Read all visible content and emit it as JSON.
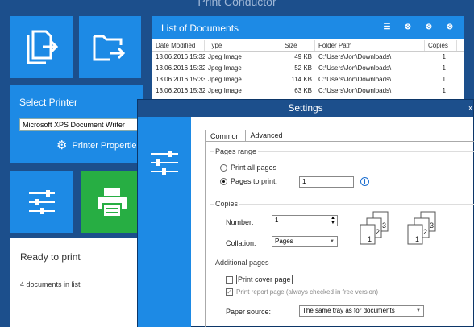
{
  "main_window": {
    "title": "Print Conductor"
  },
  "select_printer": {
    "label": "Select Printer",
    "printer_value": "Microsoft XPS Document Writer",
    "properties_label": "Printer Properties"
  },
  "status": {
    "ready": "Ready to print",
    "count": "4 documents in list"
  },
  "documents": {
    "title": "List of Documents",
    "columns": [
      "Date Modified",
      "Type",
      "Size",
      "Folder Path",
      "Copies"
    ],
    "rows": [
      {
        "date": "13.06.2016 15:32",
        "type": "Jpeg Image",
        "size": "49 KB",
        "path": "C:\\Users\\Jon\\Downloads\\",
        "copies": "1"
      },
      {
        "date": "13.06.2016 15:32",
        "type": "Jpeg Image",
        "size": "52 KB",
        "path": "C:\\Users\\Jon\\Downloads\\",
        "copies": "1"
      },
      {
        "date": "13.06.2016 15:33",
        "type": "Jpeg Image",
        "size": "114 KB",
        "path": "C:\\Users\\Jon\\Downloads\\",
        "copies": "1"
      },
      {
        "date": "13.06.2016 15:32",
        "type": "Jpeg Image",
        "size": "63 KB",
        "path": "C:\\Users\\Jon\\Downloads\\",
        "copies": "1"
      }
    ]
  },
  "settings": {
    "title": "Settings",
    "close": "x",
    "tabs": [
      "Common",
      "Advanced"
    ],
    "pages_range": {
      "title": "Pages range",
      "all_label": "Print all pages",
      "pages_label": "Pages to print:",
      "pages_value": "1",
      "info": "i"
    },
    "copies": {
      "title": "Copies",
      "number_label": "Number:",
      "number_value": "1",
      "collation_label": "Collation:",
      "collation_value": "Pages"
    },
    "additional": {
      "title": "Additional pages",
      "cover_label": "Print cover page",
      "report_label": "Print report page (always checked in free version)",
      "source_label": "Paper source:",
      "source_value": "The same tray as for documents"
    },
    "collation_pages": [
      "1",
      "2",
      "3"
    ]
  },
  "colors": {
    "accent": "#1d8ae5",
    "green": "#27ae43",
    "dark": "#1c4f8c"
  }
}
